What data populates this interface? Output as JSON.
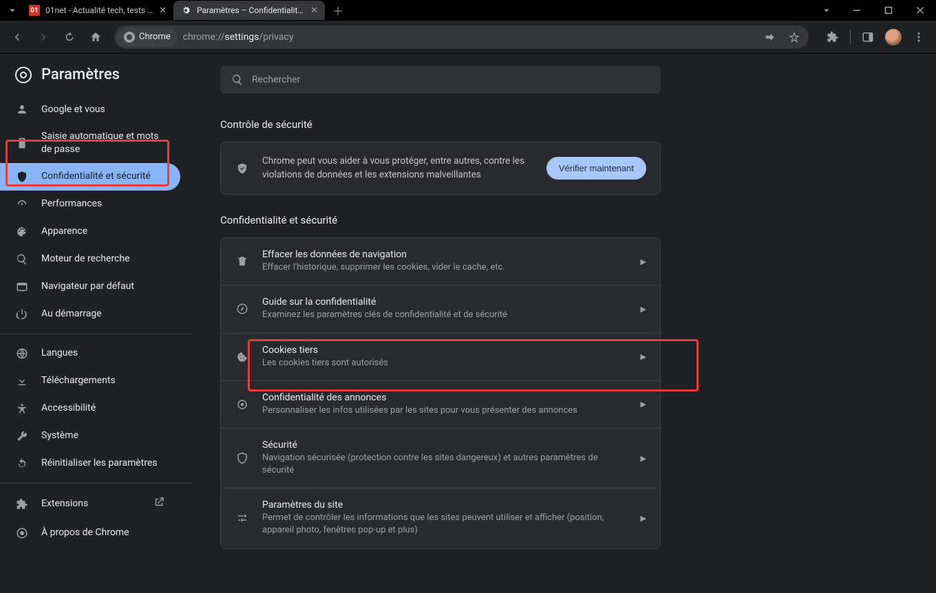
{
  "tabs": {
    "tab1_title": "01net - Actualité tech, tests prod",
    "tab2_title": "Paramètres – Confidentialité et s"
  },
  "toolbar": {
    "site_chip": "Chrome",
    "url_gray1": "chrome://",
    "url_white": "settings",
    "url_gray2": "/privacy"
  },
  "sidebar": {
    "header": "Paramètres",
    "items": [
      {
        "label": "Google et vous"
      },
      {
        "label": "Saisie automatique et mots de passe"
      },
      {
        "label": "Confidentialité et sécurité"
      },
      {
        "label": "Performances"
      },
      {
        "label": "Apparence"
      },
      {
        "label": "Moteur de recherche"
      },
      {
        "label": "Navigateur par défaut"
      },
      {
        "label": "Au démarrage"
      },
      {
        "label": "Langues"
      },
      {
        "label": "Téléchargements"
      },
      {
        "label": "Accessibilité"
      },
      {
        "label": "Système"
      },
      {
        "label": "Réinitialiser les paramètres"
      },
      {
        "label": "Extensions"
      },
      {
        "label": "À propos de Chrome"
      }
    ]
  },
  "main": {
    "search_placeholder": "Rechercher",
    "safety_header": "Contrôle de sécurité",
    "safety_text": "Chrome peut vous aider à vous protéger, entre autres, contre les violations de données et les extensions malveillantes",
    "verify_button": "Vérifier maintenant",
    "privacy_header": "Confidentialité et sécurité",
    "rows": [
      {
        "title": "Effacer les données de navigation",
        "sub": "Effacer l'historique, supprimer les cookies, vider le cache, etc."
      },
      {
        "title": "Guide sur la confidentialité",
        "sub": "Examinez les paramètres clés de confidentialité et de sécurité"
      },
      {
        "title": "Cookies tiers",
        "sub": "Les cookies tiers sont autorisés"
      },
      {
        "title": "Confidentialité des annonces",
        "sub": "Personnaliser les infos utilisées par les sites pour vous présenter des annonces"
      },
      {
        "title": "Sécurité",
        "sub": "Navigation sécurisée (protection contre les sites dangereux) et autres paramètres de sécurité"
      },
      {
        "title": "Paramètres du site",
        "sub": "Permet de contrôler les informations que les sites peuvent utiliser et afficher (position, appareil photo, fenêtres pop-up et plus)"
      }
    ]
  }
}
